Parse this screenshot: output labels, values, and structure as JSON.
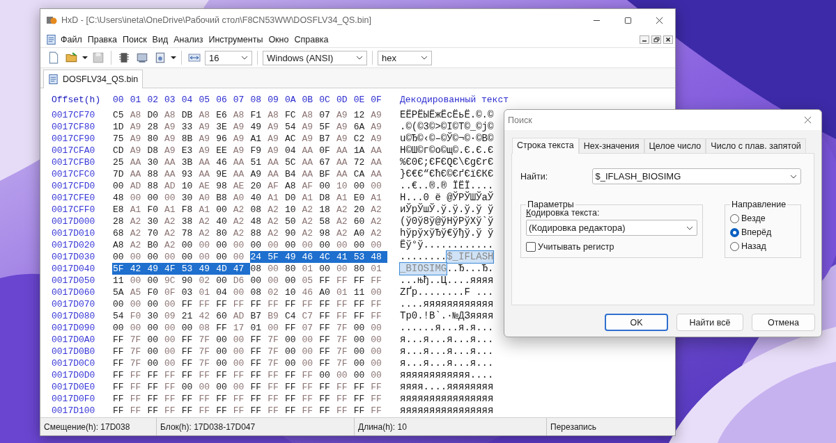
{
  "window": {
    "title": "HxD - [C:\\Users\\ineta\\OneDrive\\Рабочий стол\\F8CN53WW\\DOSFLV34_QS.bin]"
  },
  "menu": [
    "Файл",
    "Правка",
    "Поиск",
    "Вид",
    "Анализ",
    "Инструменты",
    "Окно",
    "Справка"
  ],
  "toolbar": {
    "bytes_per_row": "16",
    "encoding": "Windows (ANSI)",
    "offset_base": "hex"
  },
  "tabs": [
    {
      "label": "DOSFLV34_QS.bin",
      "selected": true
    }
  ],
  "hex_view": {
    "offset_header": "Offset(h)",
    "column_headers": [
      "00",
      "01",
      "02",
      "03",
      "04",
      "05",
      "06",
      "07",
      "08",
      "09",
      "0A",
      "0B",
      "0C",
      "0D",
      "0E",
      "0F"
    ],
    "text_header": "Декодированный текст",
    "rows": [
      {
        "offset": "0017CF70",
        "segments": [
          {
            "bytes": [
              "C5",
              "A8",
              "D0",
              "A8",
              "DB",
              "A8",
              "E6",
              "A8",
              "F1",
              "A8",
              "FC",
              "A8",
              "07",
              "A9",
              "12",
              "A9"
            ],
            "text": "ЕЁРЁЫЁжЁсЁьЁ.©.©",
            "selected": false
          }
        ]
      },
      {
        "offset": "0017CF80",
        "segments": [
          {
            "bytes": [
              "1D",
              "A9",
              "28",
              "A9",
              "33",
              "A9",
              "3E",
              "A9",
              "49",
              "A9",
              "54",
              "A9",
              "5F",
              "A9",
              "6A",
              "A9"
            ],
            "text": ".©(©3©>©I©T©_©j©",
            "selected": false
          }
        ]
      },
      {
        "offset": "0017CF90",
        "segments": [
          {
            "bytes": [
              "75",
              "A9",
              "80",
              "A9",
              "8B",
              "A9",
              "96",
              "A9",
              "A1",
              "A9",
              "AC",
              "A9",
              "B7",
              "A9",
              "C2",
              "A9"
            ],
            "text": "u©Ђ©‹©–©Ў©¬©·©В©",
            "selected": false
          }
        ]
      },
      {
        "offset": "0017CFA0",
        "segments": [
          {
            "bytes": [
              "CD",
              "A9",
              "D8",
              "A9",
              "E3",
              "A9",
              "EE",
              "A9",
              "F9",
              "A9",
              "04",
              "AA",
              "0F",
              "AA",
              "1A",
              "AA"
            ],
            "text": "Н©Ш©г©о©щ©.Є.Є.Є",
            "selected": false
          }
        ]
      },
      {
        "offset": "0017CFB0",
        "segments": [
          {
            "bytes": [
              "25",
              "AA",
              "30",
              "AA",
              "3B",
              "AA",
              "46",
              "AA",
              "51",
              "AA",
              "5C",
              "AA",
              "67",
              "AA",
              "72",
              "AA"
            ],
            "text": "%Є0Є;ЄFЄQЄ\\ЄgЄrЄ",
            "selected": false
          }
        ]
      },
      {
        "offset": "0017CFC0",
        "segments": [
          {
            "bytes": [
              "7D",
              "AA",
              "88",
              "AA",
              "93",
              "AA",
              "9E",
              "AA",
              "A9",
              "AA",
              "B4",
              "AA",
              "BF",
              "AA",
              "CA",
              "AA"
            ],
            "text": "}Є€Є“ЄћЄ©ЄґЄїЄКЄ",
            "selected": false
          }
        ]
      },
      {
        "offset": "0017CFD0",
        "segments": [
          {
            "bytes": [
              "00",
              "AD",
              "88",
              "AD",
              "10",
              "AE",
              "98",
              "AE",
              "20",
              "AF",
              "A8",
              "AF",
              "00",
              "10",
              "00",
              "00"
            ],
            "text": "..€..®.® ЇЁЇ....",
            "selected": false
          }
        ]
      },
      {
        "offset": "0017CFE0",
        "segments": [
          {
            "bytes": [
              "48",
              "00",
              "00",
              "00",
              "30",
              "A0",
              "B8",
              "A0",
              "40",
              "A1",
              "D0",
              "A1",
              "D8",
              "A1",
              "E0",
              "A1"
            ],
            "text": "H...0 ё @ЎРЎШЎаЎ",
            "selected": false
          }
        ]
      },
      {
        "offset": "0017CFF0",
        "segments": [
          {
            "bytes": [
              "E8",
              "A1",
              "F0",
              "A1",
              "F8",
              "A1",
              "00",
              "A2",
              "08",
              "A2",
              "10",
              "A2",
              "18",
              "A2",
              "20",
              "A2"
            ],
            "text": "иЎрЎшЎ.ў.ў.ў.ў ў",
            "selected": false
          }
        ]
      },
      {
        "offset": "0017D000",
        "segments": [
          {
            "bytes": [
              "28",
              "A2",
              "30",
              "A2",
              "38",
              "A2",
              "40",
              "A2",
              "48",
              "A2",
              "50",
              "A2",
              "58",
              "A2",
              "60",
              "A2"
            ],
            "text": "(ў0ў8ў@ўHўPўXў`ў",
            "selected": false
          }
        ]
      },
      {
        "offset": "0017D010",
        "segments": [
          {
            "bytes": [
              "68",
              "A2",
              "70",
              "A2",
              "78",
              "A2",
              "80",
              "A2",
              "88",
              "A2",
              "90",
              "A2",
              "98",
              "A2",
              "A0",
              "A2"
            ],
            "text": "hўpўxўЂў€ўђў.ў ў",
            "selected": false
          }
        ]
      },
      {
        "offset": "0017D020",
        "segments": [
          {
            "bytes": [
              "A8",
              "A2",
              "B0",
              "A2",
              "00",
              "00",
              "00",
              "00",
              "00",
              "00",
              "00",
              "00",
              "00",
              "00",
              "00",
              "00"
            ],
            "text": "Ёў°ў............",
            "selected": false
          }
        ]
      },
      {
        "offset": "0017D030",
        "segments": [
          {
            "bytes": [
              "00",
              "00",
              "00",
              "00",
              "00",
              "00",
              "00",
              "00"
            ],
            "text": "........",
            "selected": false
          },
          {
            "bytes": [
              "24",
              "5F",
              "49",
              "46",
              "4C",
              "41",
              "53",
              "48"
            ],
            "text": "$_IFLASH",
            "selected": true
          }
        ]
      },
      {
        "offset": "0017D040",
        "segments": [
          {
            "bytes": [
              "5F",
              "42",
              "49",
              "4F",
              "53",
              "49",
              "4D",
              "47"
            ],
            "text": "_BIOSIMG",
            "selected": true
          },
          {
            "bytes": [
              "08",
              "00",
              "80",
              "01",
              "00",
              "00",
              "80",
              "01"
            ],
            "text": "..Ђ...Ђ.",
            "selected": false
          }
        ]
      },
      {
        "offset": "0017D050",
        "segments": [
          {
            "bytes": [
              "11",
              "00",
              "00",
              "9C",
              "90",
              "02",
              "00",
              "D6",
              "00",
              "00",
              "00",
              "05",
              "FF",
              "FF",
              "FF",
              "FF"
            ],
            "text": "...њђ..Ц....яяяя",
            "selected": false
          }
        ]
      },
      {
        "offset": "0017D060",
        "segments": [
          {
            "bytes": [
              "5A",
              "A5",
              "F0",
              "0F",
              "03",
              "01",
              "04",
              "00",
              "08",
              "02",
              "10",
              "46",
              "A0",
              "01",
              "11",
              "00"
            ],
            "text": "ZҐр........F ...",
            "selected": false
          }
        ]
      },
      {
        "offset": "0017D070",
        "segments": [
          {
            "bytes": [
              "00",
              "00",
              "00",
              "00",
              "FF",
              "FF",
              "FF",
              "FF",
              "FF",
              "FF",
              "FF",
              "FF",
              "FF",
              "FF",
              "FF",
              "FF"
            ],
            "text": "....яяяяяяяяяяяя",
            "selected": false
          }
        ]
      },
      {
        "offset": "0017D080",
        "segments": [
          {
            "bytes": [
              "54",
              "F0",
              "30",
              "09",
              "21",
              "42",
              "60",
              "AD",
              "B7",
              "B9",
              "C4",
              "C7",
              "FF",
              "FF",
              "FF",
              "FF"
            ],
            "text": "Tр0.!B`.·№ДЗяяяя",
            "selected": false
          }
        ]
      },
      {
        "offset": "0017D090",
        "segments": [
          {
            "bytes": [
              "00",
              "00",
              "00",
              "00",
              "00",
              "08",
              "FF",
              "17",
              "01",
              "00",
              "FF",
              "07",
              "FF",
              "7F",
              "00",
              "00"
            ],
            "text": "......я...я.я...",
            "selected": false
          }
        ]
      },
      {
        "offset": "0017D0A0",
        "segments": [
          {
            "bytes": [
              "FF",
              "7F",
              "00",
              "00",
              "FF",
              "7F",
              "00",
              "00",
              "FF",
              "7F",
              "00",
              "00",
              "FF",
              "7F",
              "00",
              "00"
            ],
            "text": "я...я...я...я...",
            "selected": false
          }
        ]
      },
      {
        "offset": "0017D0B0",
        "segments": [
          {
            "bytes": [
              "FF",
              "7F",
              "00",
              "00",
              "FF",
              "7F",
              "00",
              "00",
              "FF",
              "7F",
              "00",
              "00",
              "FF",
              "7F",
              "00",
              "00"
            ],
            "text": "я...я...я...я...",
            "selected": false
          }
        ]
      },
      {
        "offset": "0017D0C0",
        "segments": [
          {
            "bytes": [
              "FF",
              "7F",
              "00",
              "00",
              "FF",
              "7F",
              "00",
              "00",
              "FF",
              "7F",
              "00",
              "00",
              "FF",
              "7F",
              "00",
              "00"
            ],
            "text": "я...я...я...я...",
            "selected": false
          }
        ]
      },
      {
        "offset": "0017D0D0",
        "segments": [
          {
            "bytes": [
              "FF",
              "FF",
              "FF",
              "FF",
              "FF",
              "FF",
              "FF",
              "FF",
              "FF",
              "FF",
              "FF",
              "FF",
              "00",
              "00",
              "00",
              "00"
            ],
            "text": "яяяяяяяяяяяя....",
            "selected": false
          }
        ]
      },
      {
        "offset": "0017D0E0",
        "segments": [
          {
            "bytes": [
              "FF",
              "FF",
              "FF",
              "FF",
              "00",
              "00",
              "00",
              "00",
              "FF",
              "FF",
              "FF",
              "FF",
              "FF",
              "FF",
              "FF",
              "FF"
            ],
            "text": "яяяя....яяяяяяяя",
            "selected": false
          }
        ]
      },
      {
        "offset": "0017D0F0",
        "segments": [
          {
            "bytes": [
              "FF",
              "FF",
              "FF",
              "FF",
              "FF",
              "FF",
              "FF",
              "FF",
              "FF",
              "FF",
              "FF",
              "FF",
              "FF",
              "FF",
              "FF",
              "FF"
            ],
            "text": "яяяяяяяяяяяяяяяя",
            "selected": false
          }
        ]
      },
      {
        "offset": "0017D100",
        "segments": [
          {
            "bytes": [
              "FF",
              "FF",
              "FF",
              "FF",
              "FF",
              "FF",
              "FF",
              "FF",
              "FF",
              "FF",
              "FF",
              "FF",
              "FF",
              "FF",
              "FF",
              "FF"
            ],
            "text": "яяяяяяяяяяяяяяяя",
            "selected": false
          }
        ]
      }
    ]
  },
  "status_bar": [
    "Смещение(h): 17D038",
    "Блок(h): 17D038-17D047",
    "Длина(h): 10",
    "Перезапись"
  ],
  "dialog": {
    "title": "Поиск",
    "tabs": [
      {
        "label": "Строка текста",
        "selected": true
      },
      {
        "label": "Hex-значения",
        "selected": false
      },
      {
        "label": "Целое число",
        "selected": false
      },
      {
        "label": "Число с плав. запятой",
        "selected": false
      }
    ],
    "find_label": "Найти:",
    "find_value": "$_IFLASH_BIOSIMG",
    "parameters": {
      "title": "Параметры",
      "encoding_label": "Кодировка текста:",
      "encoding_value": "(Кодировка редактора)",
      "case_sensitive": {
        "label": "Учитывать регистр",
        "checked": false
      }
    },
    "direction": {
      "title": "Направление",
      "options": [
        {
          "label": "Везде",
          "selected": false
        },
        {
          "label": "Вперёд",
          "selected": true
        },
        {
          "label": "Назад",
          "selected": false
        }
      ]
    },
    "buttons": [
      {
        "label": "OK",
        "default": true
      },
      {
        "label": "Найти всё",
        "default": false
      },
      {
        "label": "Отмена",
        "default": false
      }
    ]
  }
}
